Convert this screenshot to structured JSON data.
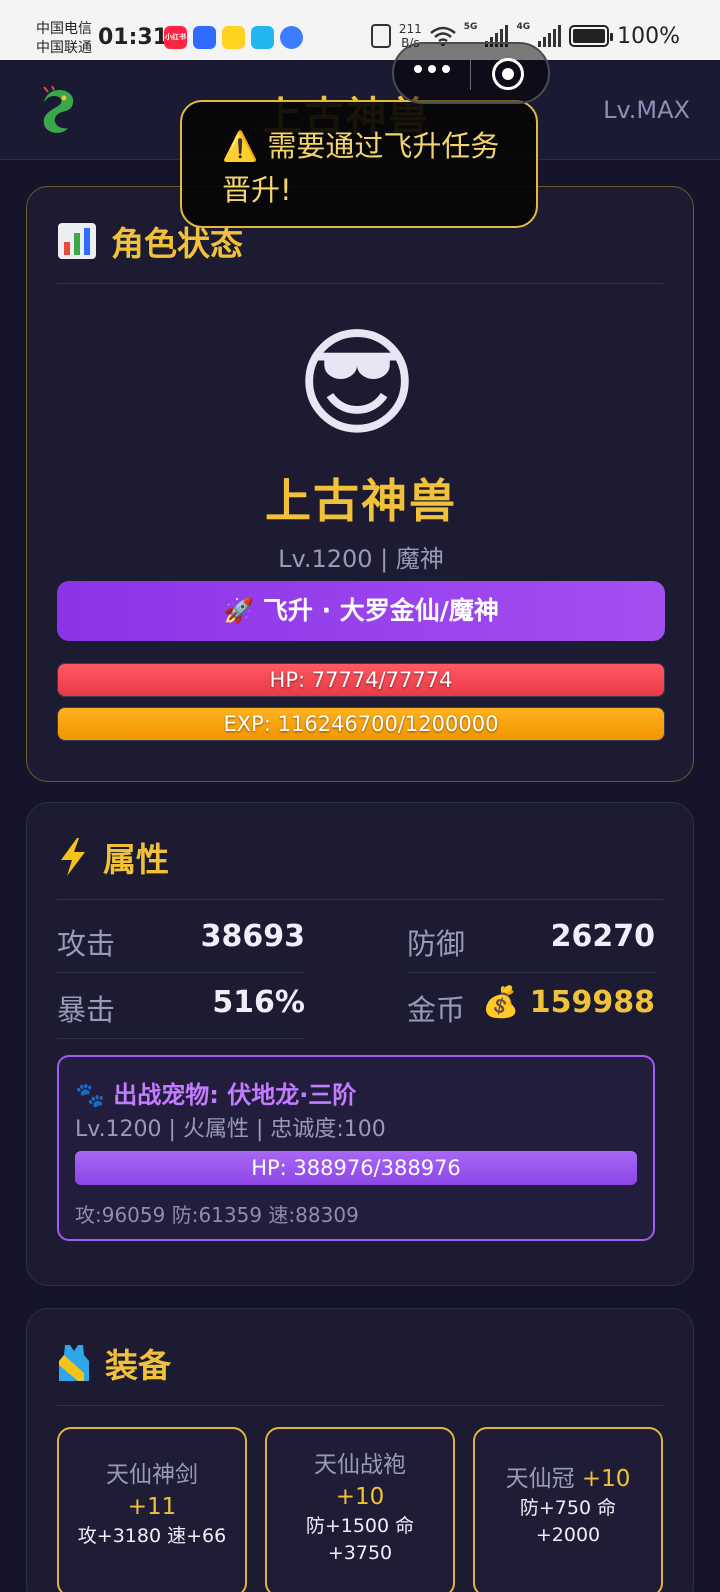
{
  "statusbar": {
    "carrier1": "中国电信",
    "carrier2": "中国联通",
    "time": "01:31",
    "net_speed_value": "211",
    "net_speed_unit": "B/s",
    "signal1_tag": "5G",
    "signal2_tag": "4G",
    "battery": "100%",
    "app_icons": [
      {
        "name": "xiaohongshu-icon",
        "label": "小红书",
        "color": "#ff2442"
      },
      {
        "name": "app-blue-icon",
        "label": "",
        "color": "#2f6bff"
      },
      {
        "name": "app-yellow-icon",
        "label": "",
        "color": "#ffd21f"
      },
      {
        "name": "book-icon",
        "label": "",
        "color": "#22b5f0"
      },
      {
        "name": "feather-icon",
        "label": "",
        "color": "#3d7cff"
      }
    ]
  },
  "header": {
    "logo_icon": "dragon-icon",
    "title": "上古神兽",
    "level": "Lv.MAX"
  },
  "toast": {
    "icon": "warning-icon",
    "text": "⚠️ 需要通过飞升任务晋升!"
  },
  "status_card": {
    "title": "角色状态",
    "icon": "bar-chart-icon",
    "avatar": "😎",
    "name": "上古神兽",
    "subtitle": "Lv.1200 | 魔神",
    "ascend_button": "🚀 飞升 · 大罗金仙/魔神",
    "hp": {
      "text": "HP: 77774/77774",
      "fraction": 1.0
    },
    "exp": {
      "text": "EXP: 116246700/1200000",
      "fraction": 1.0
    }
  },
  "attrs_card": {
    "title": "属性",
    "icon": "lightning-icon",
    "stats": [
      {
        "label": "攻击",
        "value": "38693"
      },
      {
        "label": "防御",
        "value": "26270"
      },
      {
        "label": "暴击",
        "value": "516%"
      },
      {
        "label": "金币",
        "value": "💰 159988"
      }
    ],
    "pet": {
      "title": "🐾 出战宠物: 伏地龙·三阶",
      "subtitle": "Lv.1200 | 火属性 | 忠诚度:100",
      "hp": {
        "text": "HP: 388976/388976",
        "fraction": 1.0
      },
      "stats": "攻:96059 防:61359 速:88309"
    }
  },
  "equip_card": {
    "title": "装备",
    "icon": "vest-icon",
    "items": [
      {
        "name": "天仙神剑",
        "plus": "+11",
        "stats": "攻+3180 速+66"
      },
      {
        "name": "天仙战袍",
        "plus": "+10",
        "stats": "防+1500 命+3750"
      },
      {
        "name": "天仙冠",
        "plus": "+10",
        "stats": "防+750 命+2000"
      }
    ]
  }
}
